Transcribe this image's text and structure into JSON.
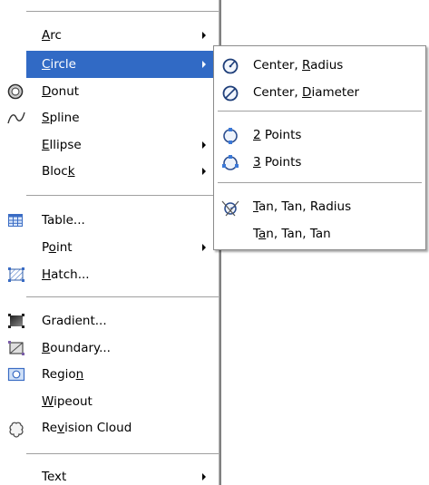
{
  "main_menu": {
    "items": [
      {
        "key": "arc",
        "pre": "",
        "ul": "A",
        "post": "rc",
        "submenu": true,
        "icon": ""
      },
      {
        "key": "circle",
        "pre": "",
        "ul": "C",
        "post": "ircle",
        "submenu": true,
        "highlighted": true,
        "icon": ""
      },
      {
        "key": "donut",
        "pre": "",
        "ul": "D",
        "post": "onut",
        "submenu": false,
        "icon": "donut-icon"
      },
      {
        "key": "spline",
        "pre": "",
        "ul": "S",
        "post": "pline",
        "submenu": false,
        "icon": "spline-icon"
      },
      {
        "key": "ellipse",
        "pre": "",
        "ul": "E",
        "post": "llipse",
        "submenu": true,
        "icon": ""
      },
      {
        "key": "block",
        "pre": "Bloc",
        "ul": "k",
        "post": "",
        "submenu": true,
        "icon": ""
      },
      {
        "key": "table",
        "pre": "Table...",
        "ul": "",
        "post": "",
        "submenu": false,
        "icon": "table-icon"
      },
      {
        "key": "point",
        "pre": "P",
        "ul": "o",
        "post": "int",
        "submenu": true,
        "icon": ""
      },
      {
        "key": "hatch",
        "pre": "",
        "ul": "H",
        "post": "atch...",
        "submenu": false,
        "icon": "hatch-icon"
      },
      {
        "key": "gradient",
        "pre": "Gradient...",
        "ul": "",
        "post": "",
        "submenu": false,
        "icon": "gradient-icon"
      },
      {
        "key": "boundary",
        "pre": "",
        "ul": "B",
        "post": "oundary...",
        "submenu": false,
        "icon": "boundary-icon"
      },
      {
        "key": "region",
        "pre": "Regio",
        "ul": "n",
        "post": "",
        "submenu": false,
        "icon": "region-icon"
      },
      {
        "key": "wipeout",
        "pre": "",
        "ul": "W",
        "post": "ipeout",
        "submenu": false,
        "icon": ""
      },
      {
        "key": "revision_cloud",
        "pre": "Re",
        "ul": "v",
        "post": "ision Cloud",
        "submenu": false,
        "icon": "revision-cloud-icon"
      },
      {
        "key": "text",
        "pre": "Text",
        "ul": "",
        "post": "",
        "submenu": true,
        "icon": ""
      }
    ]
  },
  "circle_submenu": {
    "items": [
      {
        "key": "center_radius",
        "pre": "Center, ",
        "ul": "R",
        "post": "adius",
        "icon": "center-radius-icon"
      },
      {
        "key": "center_diameter",
        "pre": "Center, ",
        "ul": "D",
        "post": "iameter",
        "icon": "center-diameter-icon"
      },
      {
        "key": "two_points",
        "pre": "",
        "ul": "2",
        "post": " Points",
        "icon": "two-points-icon"
      },
      {
        "key": "three_points",
        "pre": "",
        "ul": "3",
        "post": " Points",
        "icon": "three-points-icon"
      },
      {
        "key": "tan_tan_radius",
        "pre": "",
        "ul": "T",
        "post": "an, Tan, Radius",
        "icon": "tan-tan-radius-icon"
      },
      {
        "key": "tan_tan_tan",
        "pre": "T",
        "ul": "a",
        "post": "n, Tan, Tan",
        "icon": ""
      }
    ]
  },
  "colors": {
    "highlight": "#316ac5",
    "separator": "#a0a0a0"
  }
}
